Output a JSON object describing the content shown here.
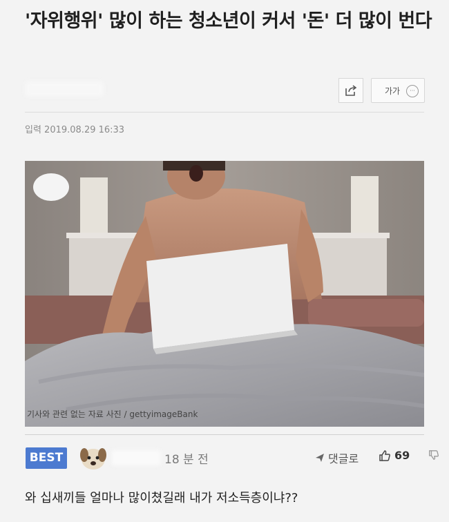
{
  "article": {
    "title": "'자위행위' 많이 하는 청소년이 커서 '돈' 더 많이 번다",
    "date": "입력 2019.08.29 16:33",
    "font_size_label": "가가",
    "more_icon_label": "···",
    "photo_caption": "기사와 관련 없는 자료 사진 / gettyimageBank"
  },
  "comment": {
    "badge": "BEST",
    "time": "18 분 전",
    "reply_label": "댓글로",
    "likes": "69",
    "text": "와 십새끼들 얼마나 많이쳤길래 내가 저소득층이냐??"
  },
  "icons": {
    "share": "share-icon",
    "more": "more-icon",
    "reply": "reply-arrow-icon",
    "like": "thumbs-up-icon",
    "dislike": "thumbs-down-icon"
  },
  "colors": {
    "best_badge": "#4c7ad0",
    "page_bg": "#f3f3f3"
  }
}
